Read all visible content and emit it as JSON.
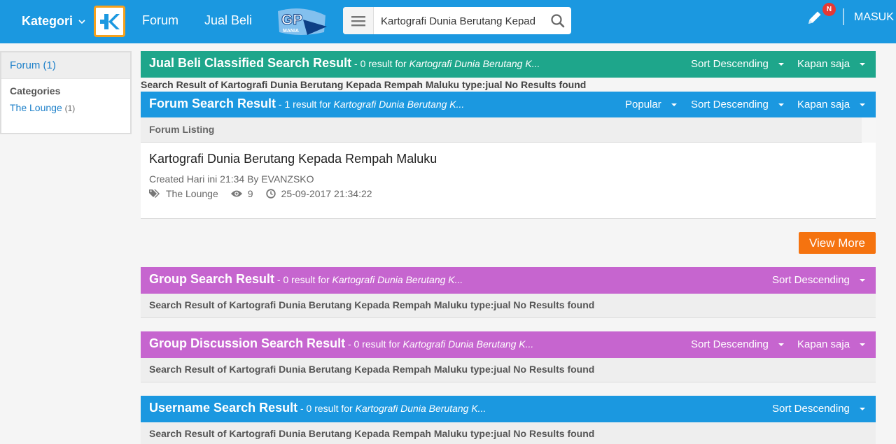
{
  "nav": {
    "kategori_label": "Kategori",
    "forum_label": "Forum",
    "jual_beli_label": "Jual Beli",
    "gp_logo_text": "GP",
    "gp_logo_sub": "MANIA",
    "search_value": "Kartografi Dunia Berutang Kepad",
    "notif_count": "N",
    "masuk_label": "MASUK",
    "brand_color": "#1b98e0"
  },
  "sidebar": {
    "active_item": "Forum (1)",
    "categories_title": "Categories",
    "categories": [
      {
        "label": "The Lounge",
        "count": "(1)"
      }
    ]
  },
  "jual_beli": {
    "title": "Jual Beli Classified Search Result",
    "sub_prefix": " - 0 result for ",
    "query": "Kartografi Dunia Berutang K...",
    "sort_label": "Sort Descending",
    "time_label": "Kapan saja",
    "no_result": "Search Result of Kartografi Dunia Berutang Kepada Rempah Maluku type:jual No Results found",
    "color": "#1ea68b"
  },
  "forum": {
    "title": "Forum Search Result",
    "sub_prefix": " - 1 result for ",
    "query": "Kartografi Dunia Berutang K...",
    "popular_label": "Popular",
    "sort_label": "Sort Descending",
    "time_label": "Kapan saja",
    "listing_label": "Forum Listing",
    "thread": {
      "title": "Kartografi Dunia Berutang Kepada Rempah Maluku",
      "meta": "Created Hari ini 21:34 By EVANZSKO",
      "category": "The Lounge",
      "views": "9",
      "datetime": "25-09-2017 21:34:22"
    },
    "view_more_label": "View More"
  },
  "group": {
    "title": "Group Search Result",
    "sub_prefix": " - 0 result for ",
    "query": "Kartografi Dunia Berutang K...",
    "sort_label": "Sort Descending",
    "no_result": "Search Result of Kartografi Dunia Berutang Kepada Rempah Maluku type:jual No Results found",
    "color": "#c665cf"
  },
  "group_discussion": {
    "title": "Group Discussion Search Result",
    "sub_prefix": " - 0 result for ",
    "query": "Kartografi Dunia Berutang K...",
    "sort_label": "Sort Descending",
    "time_label": "Kapan saja",
    "no_result": "Search Result of Kartografi Dunia Berutang Kepada Rempah Maluku type:jual No Results found"
  },
  "username": {
    "title": "Username Search Result",
    "sub_prefix": " - 0 result for ",
    "query": "Kartografi Dunia Berutang K...",
    "sort_label": "Sort Descending",
    "no_result": "Search Result of Kartografi Dunia Berutang Kepada Rempah Maluku type:jual No Results found"
  }
}
